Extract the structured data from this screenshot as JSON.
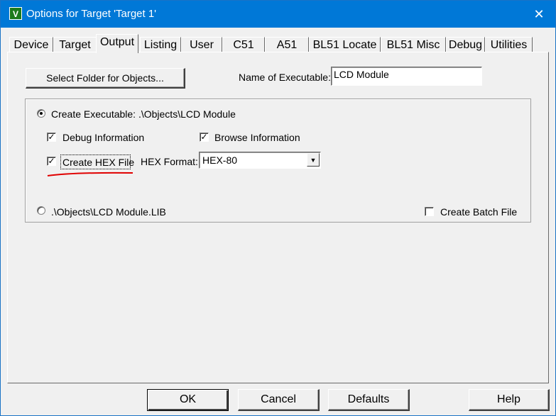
{
  "window": {
    "title": "Options for Target 'Target 1'",
    "close_glyph": "✕",
    "icon_glyph": "V"
  },
  "tabs": [
    "Device",
    "Target",
    "Output",
    "Listing",
    "User",
    "C51",
    "A51",
    "BL51 Locate",
    "BL51 Misc",
    "Debug",
    "Utilities"
  ],
  "active_tab": "Output",
  "output": {
    "select_folder_label": "Select Folder for Objects...",
    "name_label": "Name of Executable:",
    "name_value": "LCD Module",
    "create_executable_label": "Create Executable:  .\\Objects\\LCD Module",
    "create_executable_selected": true,
    "debug_info_label": "Debug Information",
    "debug_info_checked": true,
    "browse_info_label": "Browse Information",
    "browse_info_checked": true,
    "create_hex_label": "Create HEX File",
    "create_hex_checked": true,
    "hex_format_label": "HEX Format:",
    "hex_format_value": "HEX-80",
    "create_library_label": ".\\Objects\\LCD Module.LIB",
    "create_library_selected": false,
    "create_batch_label": "Create Batch File",
    "create_batch_checked": false
  },
  "buttons": {
    "ok": "OK",
    "cancel": "Cancel",
    "defaults": "Defaults",
    "help": "Help"
  },
  "colors": {
    "titlebar": "#0078d7",
    "annotation": "#e00000"
  }
}
